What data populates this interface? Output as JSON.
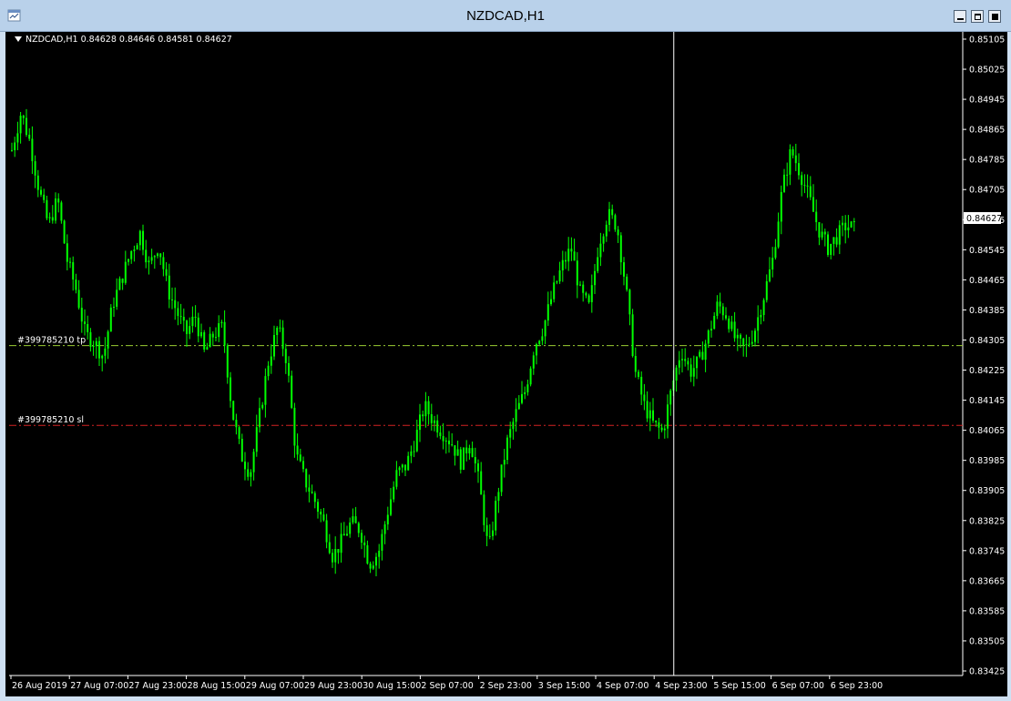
{
  "window": {
    "title": "NZDCAD,H1"
  },
  "chart_header": {
    "text": "NZDCAD,H1  0.84628 0.84646 0.84581 0.84627"
  },
  "chart_data": {
    "type": "candlestick",
    "symbol": "NZDCAD",
    "timeframe": "H1",
    "ohlc_current": {
      "open": 0.84628,
      "high": 0.84646,
      "low": 0.84581,
      "close": 0.84627
    },
    "current_price_label": "0.84627",
    "ylim": [
      0.83425,
      0.85105
    ],
    "y_ticks": [
      "0.85105",
      "0.85025",
      "0.84945",
      "0.84865",
      "0.84785",
      "0.84705",
      "0.84625",
      "0.84545",
      "0.84465",
      "0.84385",
      "0.84305",
      "0.84225",
      "0.84145",
      "0.84065",
      "0.83985",
      "0.83905",
      "0.83825",
      "0.83745",
      "0.83665",
      "0.83585",
      "0.83505",
      "0.83425"
    ],
    "x_ticks": [
      "26 Aug 2019",
      "27 Aug 07:00",
      "27 Aug 23:00",
      "28 Aug 15:00",
      "29 Aug 07:00",
      "29 Aug 23:00",
      "30 Aug 15:00",
      "2 Sep 07:00",
      "2 Sep 23:00",
      "3 Sep 15:00",
      "4 Sep 07:00",
      "4 Sep 23:00",
      "5 Sep 15:00",
      "6 Sep 07:00",
      "6 Sep 23:00"
    ],
    "levels": [
      {
        "label": "#399785210 tp",
        "value": 0.8429,
        "color": "#9acd32"
      },
      {
        "label": "#399785210 sl",
        "value": 0.84078,
        "color": "#d22222"
      }
    ],
    "crosshair_x_ratio": 0.697,
    "candle_color": "#00ff00",
    "background": "#000000",
    "path_anchors": [
      [
        0,
        0.8481
      ],
      [
        2,
        0.8491
      ],
      [
        4,
        0.8483
      ],
      [
        6,
        0.847
      ],
      [
        8,
        0.8461
      ],
      [
        10,
        0.8468
      ],
      [
        12,
        0.8452
      ],
      [
        14,
        0.8444
      ],
      [
        16,
        0.8432
      ],
      [
        18,
        0.843
      ],
      [
        20,
        0.8426
      ],
      [
        22,
        0.844
      ],
      [
        24,
        0.8447
      ],
      [
        26,
        0.8454
      ],
      [
        28,
        0.8459
      ],
      [
        30,
        0.845
      ],
      [
        32,
        0.8456
      ],
      [
        34,
        0.8444
      ],
      [
        36,
        0.8438
      ],
      [
        38,
        0.8432
      ],
      [
        40,
        0.8437
      ],
      [
        42,
        0.8427
      ],
      [
        44,
        0.8432
      ],
      [
        46,
        0.8434
      ],
      [
        48,
        0.8412
      ],
      [
        50,
        0.84
      ],
      [
        52,
        0.8395
      ],
      [
        54,
        0.841
      ],
      [
        56,
        0.8425
      ],
      [
        58,
        0.8434
      ],
      [
        60,
        0.8425
      ],
      [
        62,
        0.84
      ],
      [
        64,
        0.8393
      ],
      [
        66,
        0.8388
      ],
      [
        68,
        0.8382
      ],
      [
        70,
        0.8373
      ],
      [
        72,
        0.8377
      ],
      [
        74,
        0.8382
      ],
      [
        76,
        0.838
      ],
      [
        78,
        0.8371
      ],
      [
        80,
        0.8374
      ],
      [
        82,
        0.8385
      ],
      [
        84,
        0.8395
      ],
      [
        86,
        0.8397
      ],
      [
        88,
        0.8404
      ],
      [
        90,
        0.8413
      ],
      [
        92,
        0.8409
      ],
      [
        94,
        0.8406
      ],
      [
        96,
        0.8403
      ],
      [
        98,
        0.8398
      ],
      [
        100,
        0.8404
      ],
      [
        102,
        0.8392
      ],
      [
        104,
        0.8374
      ],
      [
        106,
        0.839
      ],
      [
        108,
        0.8403
      ],
      [
        110,
        0.8411
      ],
      [
        112,
        0.8417
      ],
      [
        114,
        0.8429
      ],
      [
        116,
        0.8434
      ],
      [
        118,
        0.8443
      ],
      [
        120,
        0.845
      ],
      [
        122,
        0.8455
      ],
      [
        124,
        0.8443
      ],
      [
        126,
        0.8439
      ],
      [
        128,
        0.8456
      ],
      [
        130,
        0.8464
      ],
      [
        132,
        0.8461
      ],
      [
        134,
        0.8444
      ],
      [
        136,
        0.8422
      ],
      [
        138,
        0.8413
      ],
      [
        140,
        0.8408
      ],
      [
        142,
        0.8406
      ],
      [
        144,
        0.8418
      ],
      [
        146,
        0.8428
      ],
      [
        148,
        0.8422
      ],
      [
        150,
        0.8425
      ],
      [
        152,
        0.8432
      ],
      [
        154,
        0.844
      ],
      [
        156,
        0.8437
      ],
      [
        158,
        0.843
      ],
      [
        160,
        0.8428
      ],
      [
        162,
        0.8433
      ],
      [
        164,
        0.8442
      ],
      [
        166,
        0.8452
      ],
      [
        168,
        0.847
      ],
      [
        170,
        0.8481
      ],
      [
        172,
        0.8475
      ],
      [
        174,
        0.8468
      ],
      [
        176,
        0.846
      ],
      [
        178,
        0.8455
      ],
      [
        180,
        0.8458
      ],
      [
        182,
        0.8461
      ],
      [
        184,
        0.846
      ]
    ]
  }
}
